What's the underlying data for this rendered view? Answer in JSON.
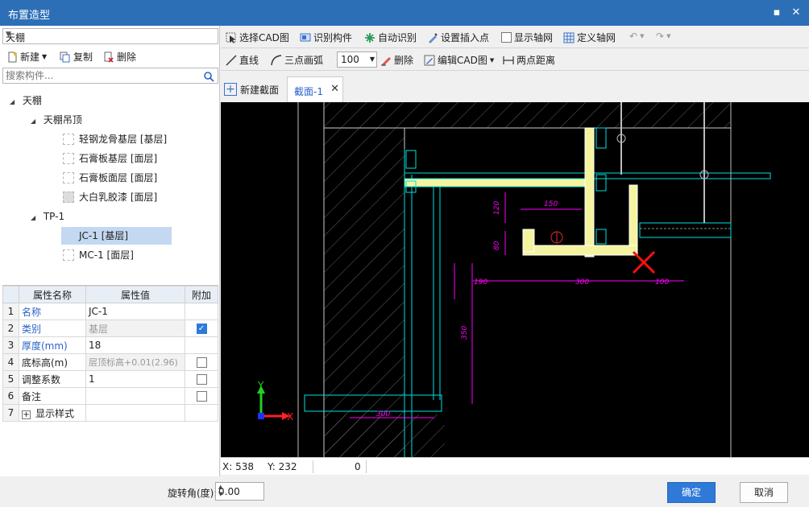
{
  "window": {
    "title": "布置造型"
  },
  "left": {
    "combo_value": "天棚",
    "toolbar": {
      "new": "新建",
      "copy": "复制",
      "delete": "删除"
    },
    "search_placeholder": "搜索构件...",
    "tree": [
      {
        "label": "天棚",
        "level": 0,
        "expanded": true
      },
      {
        "label": "天棚吊顶",
        "level": 1,
        "expanded": true
      },
      {
        "label": "轻钢龙骨基层 [基层]",
        "level": 2
      },
      {
        "label": "石膏板基层 [面层]",
        "level": 2
      },
      {
        "label": "石膏板面层 [面层]",
        "level": 2
      },
      {
        "label": "大白乳胶漆 [面层]",
        "level": 2
      },
      {
        "label": "TP-1",
        "level": 1,
        "expanded": true
      },
      {
        "label": "JC-1 [基层]",
        "level": 2,
        "selected": true
      },
      {
        "label": "MC-1 [面层]",
        "level": 2
      }
    ],
    "props": {
      "headers": [
        "属性名称",
        "属性值",
        "附加"
      ],
      "rows": [
        {
          "num": "1",
          "name": "名称",
          "value": "JC-1",
          "check": null
        },
        {
          "num": "2",
          "name": "类别",
          "value": "基层",
          "check": true
        },
        {
          "num": "3",
          "name": "厚度(mm)",
          "value": "18",
          "check": null
        },
        {
          "num": "4",
          "name": "底标高(m)",
          "value": "层顶标高+0.01(2.96)",
          "check": false
        },
        {
          "num": "5",
          "name": "调整系数",
          "value": "1",
          "check": false
        },
        {
          "num": "6",
          "name": "备注",
          "value": "",
          "check": false
        },
        {
          "num": "7",
          "name": "显示样式",
          "value": "",
          "check": null
        }
      ]
    }
  },
  "toolbar1": {
    "select_cad": "选择CAD图",
    "identify": "识别构件",
    "auto_identify": "自动识别",
    "insert_point": "设置插入点",
    "show_grid": "显示轴网",
    "define_grid": "定义轴网"
  },
  "toolbar2": {
    "line": "直线",
    "arc": "三点画弧",
    "size": "100",
    "delete": "删除",
    "edit_cad": "编辑CAD图",
    "distance": "两点距离"
  },
  "tabs": {
    "new_section": "新建截面",
    "active": "截面-1"
  },
  "canvas": {
    "axis_x": "X",
    "axis_y": "Y",
    "dims": [
      "150",
      "120",
      "80",
      "190",
      "300",
      "100",
      "350",
      "300"
    ],
    "colors": {
      "background": "#000000",
      "dim": "#ff00ff",
      "wall": "#00e0e0",
      "board": "#f4f4a0",
      "mark": "#ff1010"
    }
  },
  "status": {
    "x": "X: 538",
    "y": "Y: 232",
    "val": "0"
  },
  "bottom": {
    "rotation_label": "旋转角(度):",
    "rotation_value": "0.00",
    "ok": "确定",
    "cancel": "取消"
  },
  "accent": "#2d6fb7"
}
